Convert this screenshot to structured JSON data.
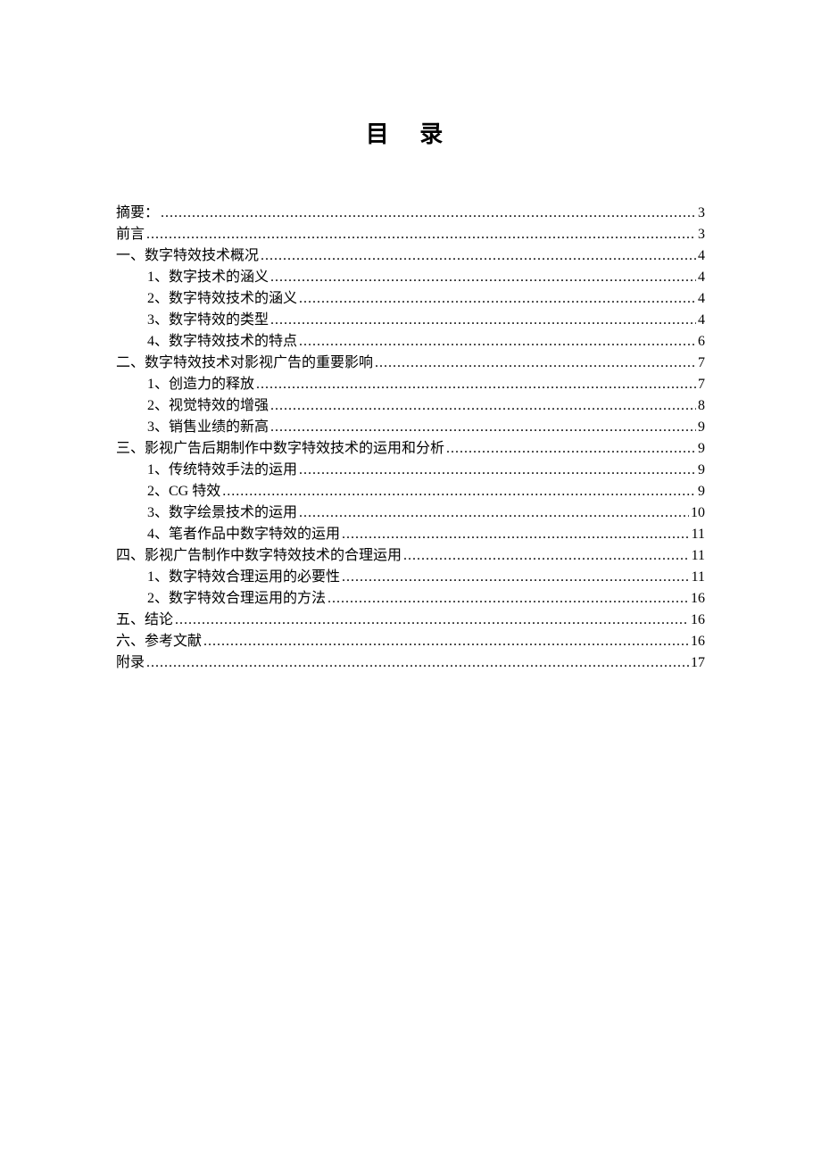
{
  "title": "目 录",
  "entries": [
    {
      "level": 1,
      "label": "摘要：",
      "page": "3"
    },
    {
      "level": 1,
      "label": "前言",
      "page": "3"
    },
    {
      "level": 1,
      "label": "一、数字特效技术概况",
      "page": "4"
    },
    {
      "level": 2,
      "label": "1、数字技术的涵义",
      "page": "4"
    },
    {
      "level": 2,
      "label": "2、数字特效技术的涵义",
      "page": "4"
    },
    {
      "level": 2,
      "label": "3、数字特效的类型",
      "page": "4"
    },
    {
      "level": 2,
      "label": "4、数字特效技术的特点",
      "page": "6"
    },
    {
      "level": 1,
      "label": "二、数字特效技术对影视广告的重要影响",
      "page": "7"
    },
    {
      "level": 2,
      "label": "1、创造力的释放",
      "page": "7"
    },
    {
      "level": 2,
      "label": "2、视觉特效的增强",
      "page": "8"
    },
    {
      "level": 2,
      "label": "3、销售业绩的新高",
      "page": "9"
    },
    {
      "level": 1,
      "label": "三、影视广告后期制作中数字特效技术的运用和分析",
      "page": "9"
    },
    {
      "level": 2,
      "label": "1、传统特效手法的运用",
      "page": "9"
    },
    {
      "level": 2,
      "label": "2、CG 特效",
      "page": "9"
    },
    {
      "level": 2,
      "label": "3、数字绘景技术的运用",
      "page": "10"
    },
    {
      "level": 2,
      "label": "4、笔者作品中数字特效的运用",
      "page": "11"
    },
    {
      "level": 1,
      "label": "四、影视广告制作中数字特效技术的合理运用",
      "page": "11"
    },
    {
      "level": 2,
      "label": "1、数字特效合理运用的必要性",
      "page": "11"
    },
    {
      "level": 2,
      "label": "2、数字特效合理运用的方法",
      "page": "16"
    },
    {
      "level": 1,
      "label": "五、结论",
      "page": "16"
    },
    {
      "level": 1,
      "label": "六、参考文献",
      "page": "16"
    },
    {
      "level": 1,
      "label": "附录",
      "page": "17"
    }
  ]
}
